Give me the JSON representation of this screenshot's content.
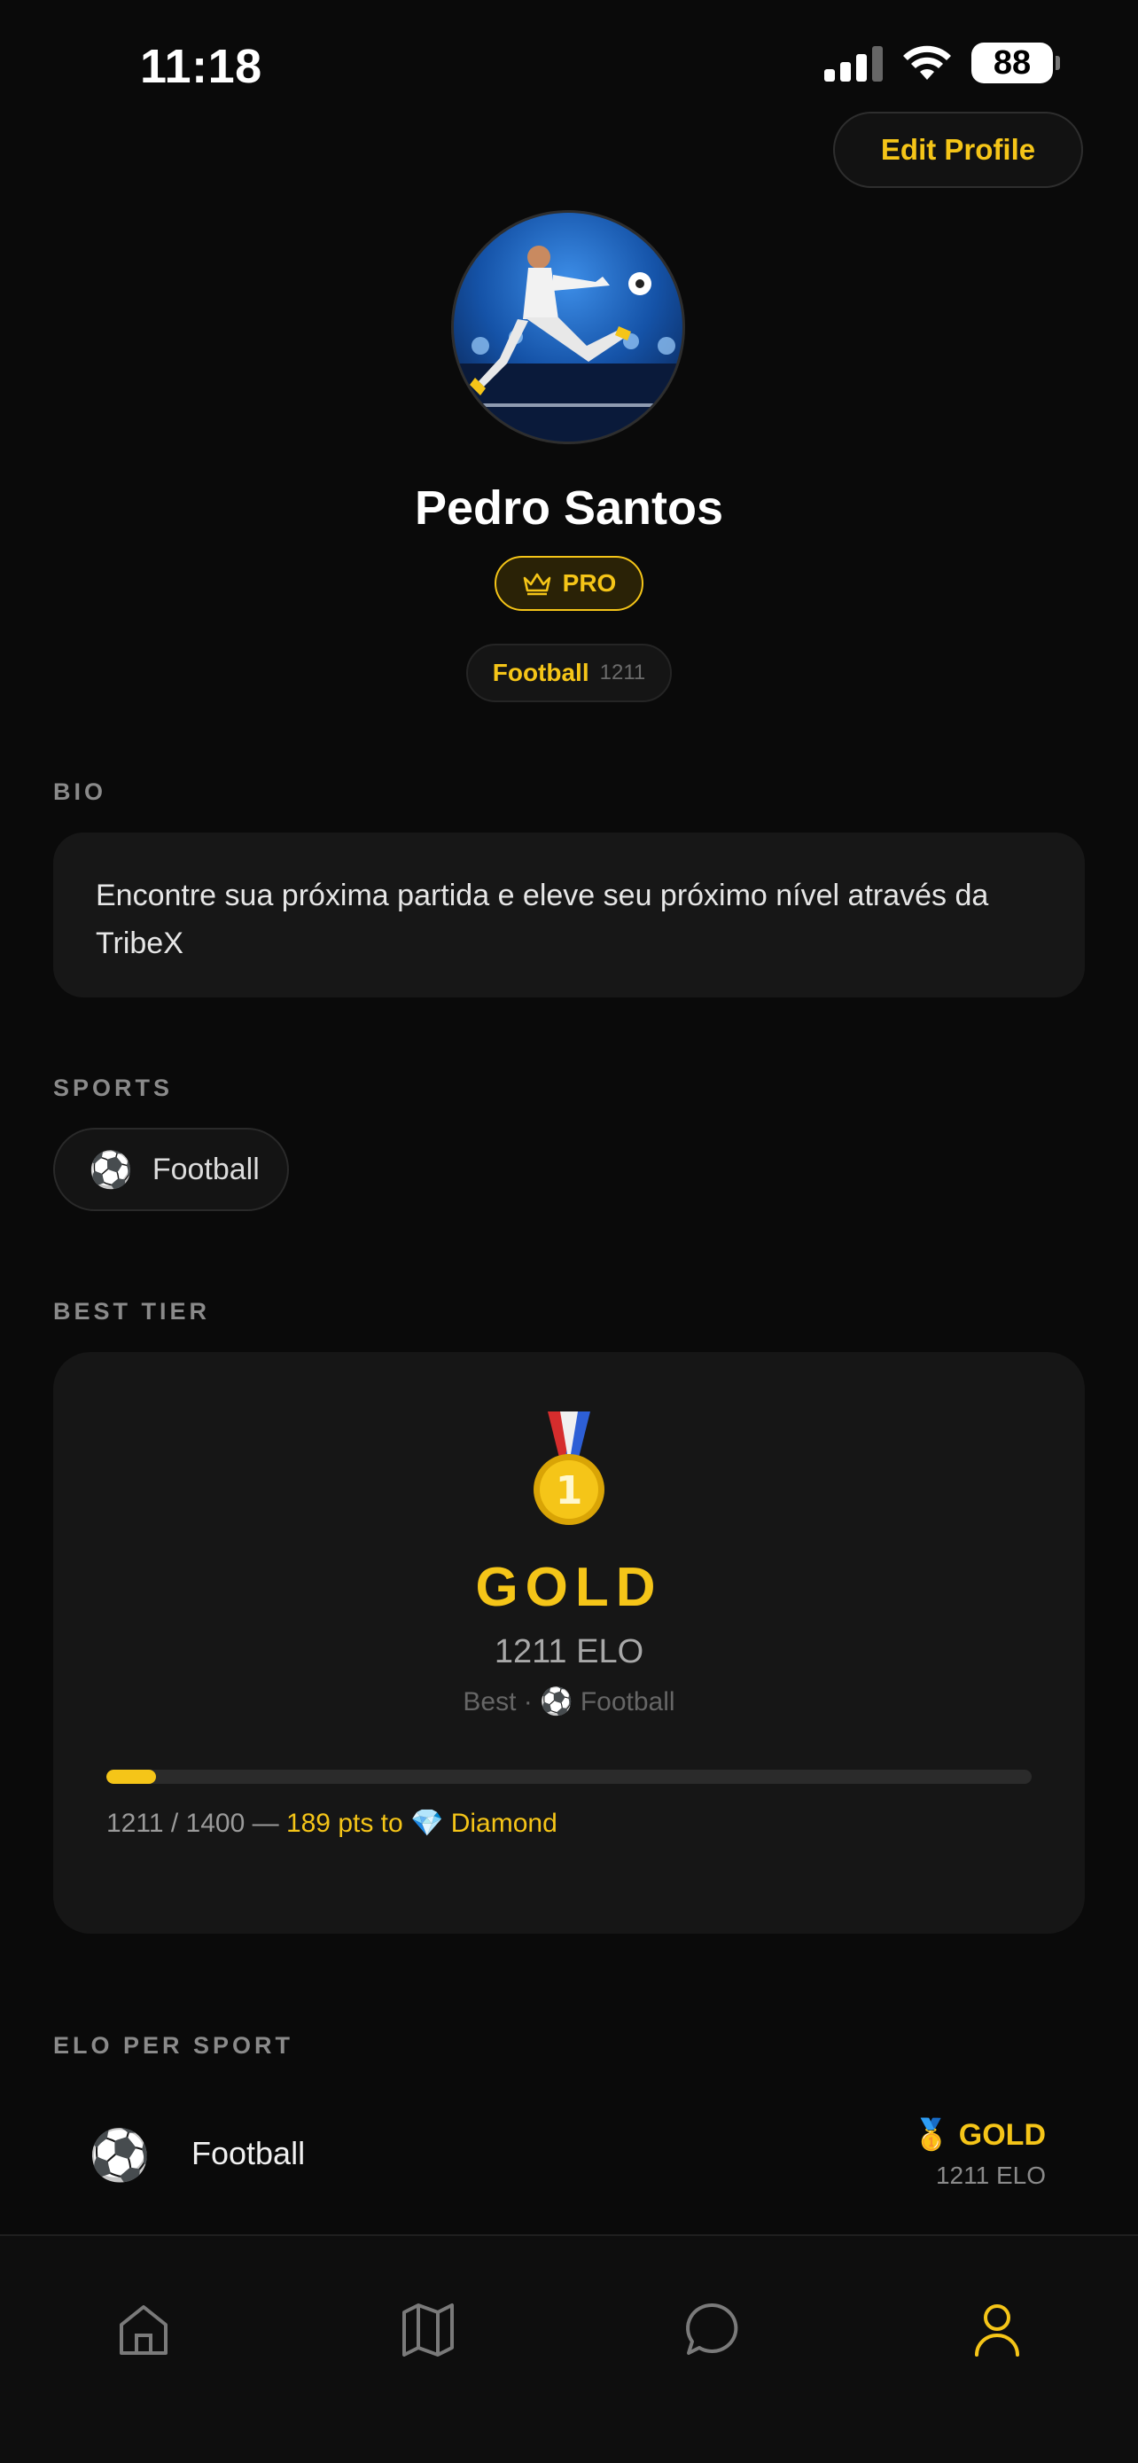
{
  "status_bar": {
    "time": "11:18",
    "battery": "88"
  },
  "header": {
    "edit_profile_label": "Edit Profile"
  },
  "profile": {
    "name": "Pedro Santos",
    "badge": "PRO",
    "primary_sport": "Football",
    "primary_sport_elo": "1211"
  },
  "bio": {
    "label": "BIO",
    "text": "Encontre sua próxima partida e eleve seu próximo nível através da TribeX"
  },
  "sports": {
    "label": "SPORTS",
    "items": [
      {
        "icon": "⚽",
        "name": "Football"
      }
    ]
  },
  "best_tier": {
    "label": "BEST TIER",
    "medal_icon": "gold-medal-icon",
    "tier": "GOLD",
    "elo": "1211 ELO",
    "best_prefix": "Best ·",
    "best_sport_icon": "⚽",
    "best_sport": "Football",
    "progress": {
      "current": 1211,
      "target": 1400,
      "fraction": 0.054
    },
    "progress_text_base": "1211 / 1400 —",
    "progress_text_highlight": "189 pts to 💎 Diamond"
  },
  "elo_per_sport": {
    "label": "ELO PER SPORT",
    "rows": [
      {
        "icon": "⚽",
        "sport": "Football",
        "tier_icon": "🥇",
        "tier": "GOLD",
        "elo": "1211 ELO"
      }
    ]
  },
  "tab_bar": {
    "active_color": "#f5c518",
    "inactive_color": "#7a7a7a",
    "tabs": [
      "home-icon",
      "map-icon",
      "chat-icon",
      "profile-icon"
    ]
  },
  "colors": {
    "accent": "#f5c518",
    "background": "#0a0a0a",
    "card": "#171717"
  }
}
